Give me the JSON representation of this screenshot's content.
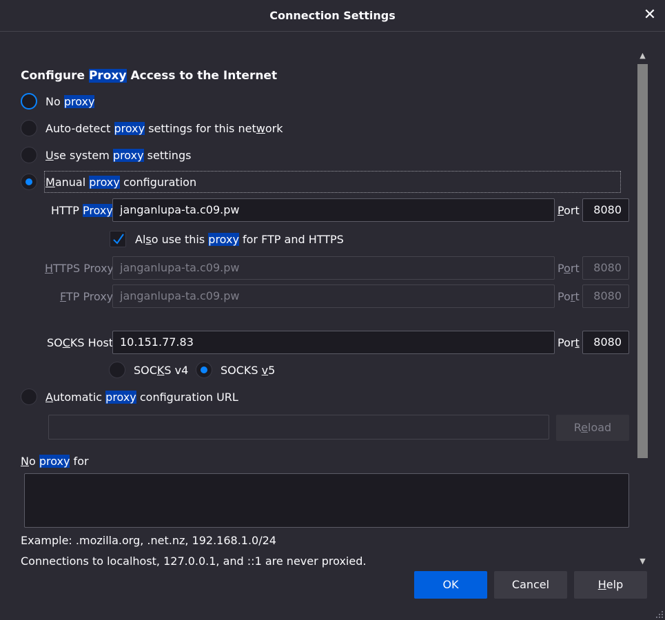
{
  "window": {
    "title": "Connection Settings",
    "close_glyph": "✕"
  },
  "heading": {
    "pre": "Configure ",
    "hl": "Proxy",
    "post": " Access to the Internet"
  },
  "options": {
    "no_proxy": {
      "pre": "No ",
      "hl": "proxy",
      "post": ""
    },
    "auto_detect": {
      "pre": "Auto-detect ",
      "hl": "proxy",
      "post1": " settings for this net",
      "ul": "w",
      "post2": "ork"
    },
    "system": {
      "ul": "U",
      "pre": "se system ",
      "hl": "proxy",
      "post": " settings"
    },
    "manual": {
      "ul": "M",
      "pre": "anual ",
      "hl": "proxy",
      "post": " configuration"
    },
    "auto_url": {
      "ul": "A",
      "pre": "utomatic ",
      "hl": "proxy",
      "post": " configuration URL"
    }
  },
  "http": {
    "label_pre": "HTTP ",
    "label_hl": "Proxy",
    "value": "janganlupa-ta.c09.pw",
    "port_ul": "P",
    "port_rest": "ort",
    "port": "8080"
  },
  "also_use": {
    "pre1": "Al",
    "ul": "s",
    "pre2": "o use this ",
    "hl": "proxy",
    "post": " for FTP and HTTPS",
    "checked": true
  },
  "https": {
    "label_ul": "H",
    "label_rest": "TTPS ",
    "label_hl": "Proxy",
    "value": "janganlupa-ta.c09.pw",
    "port_pre": "P",
    "port_ul": "o",
    "port_rest": "rt",
    "port": "8080"
  },
  "ftp": {
    "label_ul": "F",
    "label_rest": "TP ",
    "label_hl": "Proxy",
    "value": "janganlupa-ta.c09.pw",
    "port_pre": "Po",
    "port_ul": "r",
    "port_rest": "t",
    "port": "8080"
  },
  "socks": {
    "label_pre": "SO",
    "label_ul": "C",
    "label_rest": "KS Host",
    "value": "10.151.77.83",
    "port_pre": "Por",
    "port_ul": "t",
    "port_rest": "",
    "port": "8080",
    "v4": {
      "pre": "SOC",
      "ul": "K",
      "post": "S v4"
    },
    "v5": {
      "pre": "SOCKS ",
      "ul": "v",
      "post": "5"
    }
  },
  "auto_url_input": {
    "value": ""
  },
  "reload": {
    "pre": "R",
    "ul": "e",
    "post": "load"
  },
  "no_proxy_for": {
    "ul": "N",
    "pre": "o ",
    "hl": "proxy",
    "post": " for"
  },
  "example": "Example: .mozilla.org, .net.nz, 192.168.1.0/24",
  "localhost_note": "Connections to localhost, 127.0.0.1, and ::1 are never proxied.",
  "buttons": {
    "ok": "OK",
    "cancel": "Cancel",
    "help_ul": "H",
    "help_rest": "elp"
  },
  "colors": {
    "accent": "#0a84ff",
    "highlight": "#0040b0",
    "primary_button": "#0060df"
  }
}
